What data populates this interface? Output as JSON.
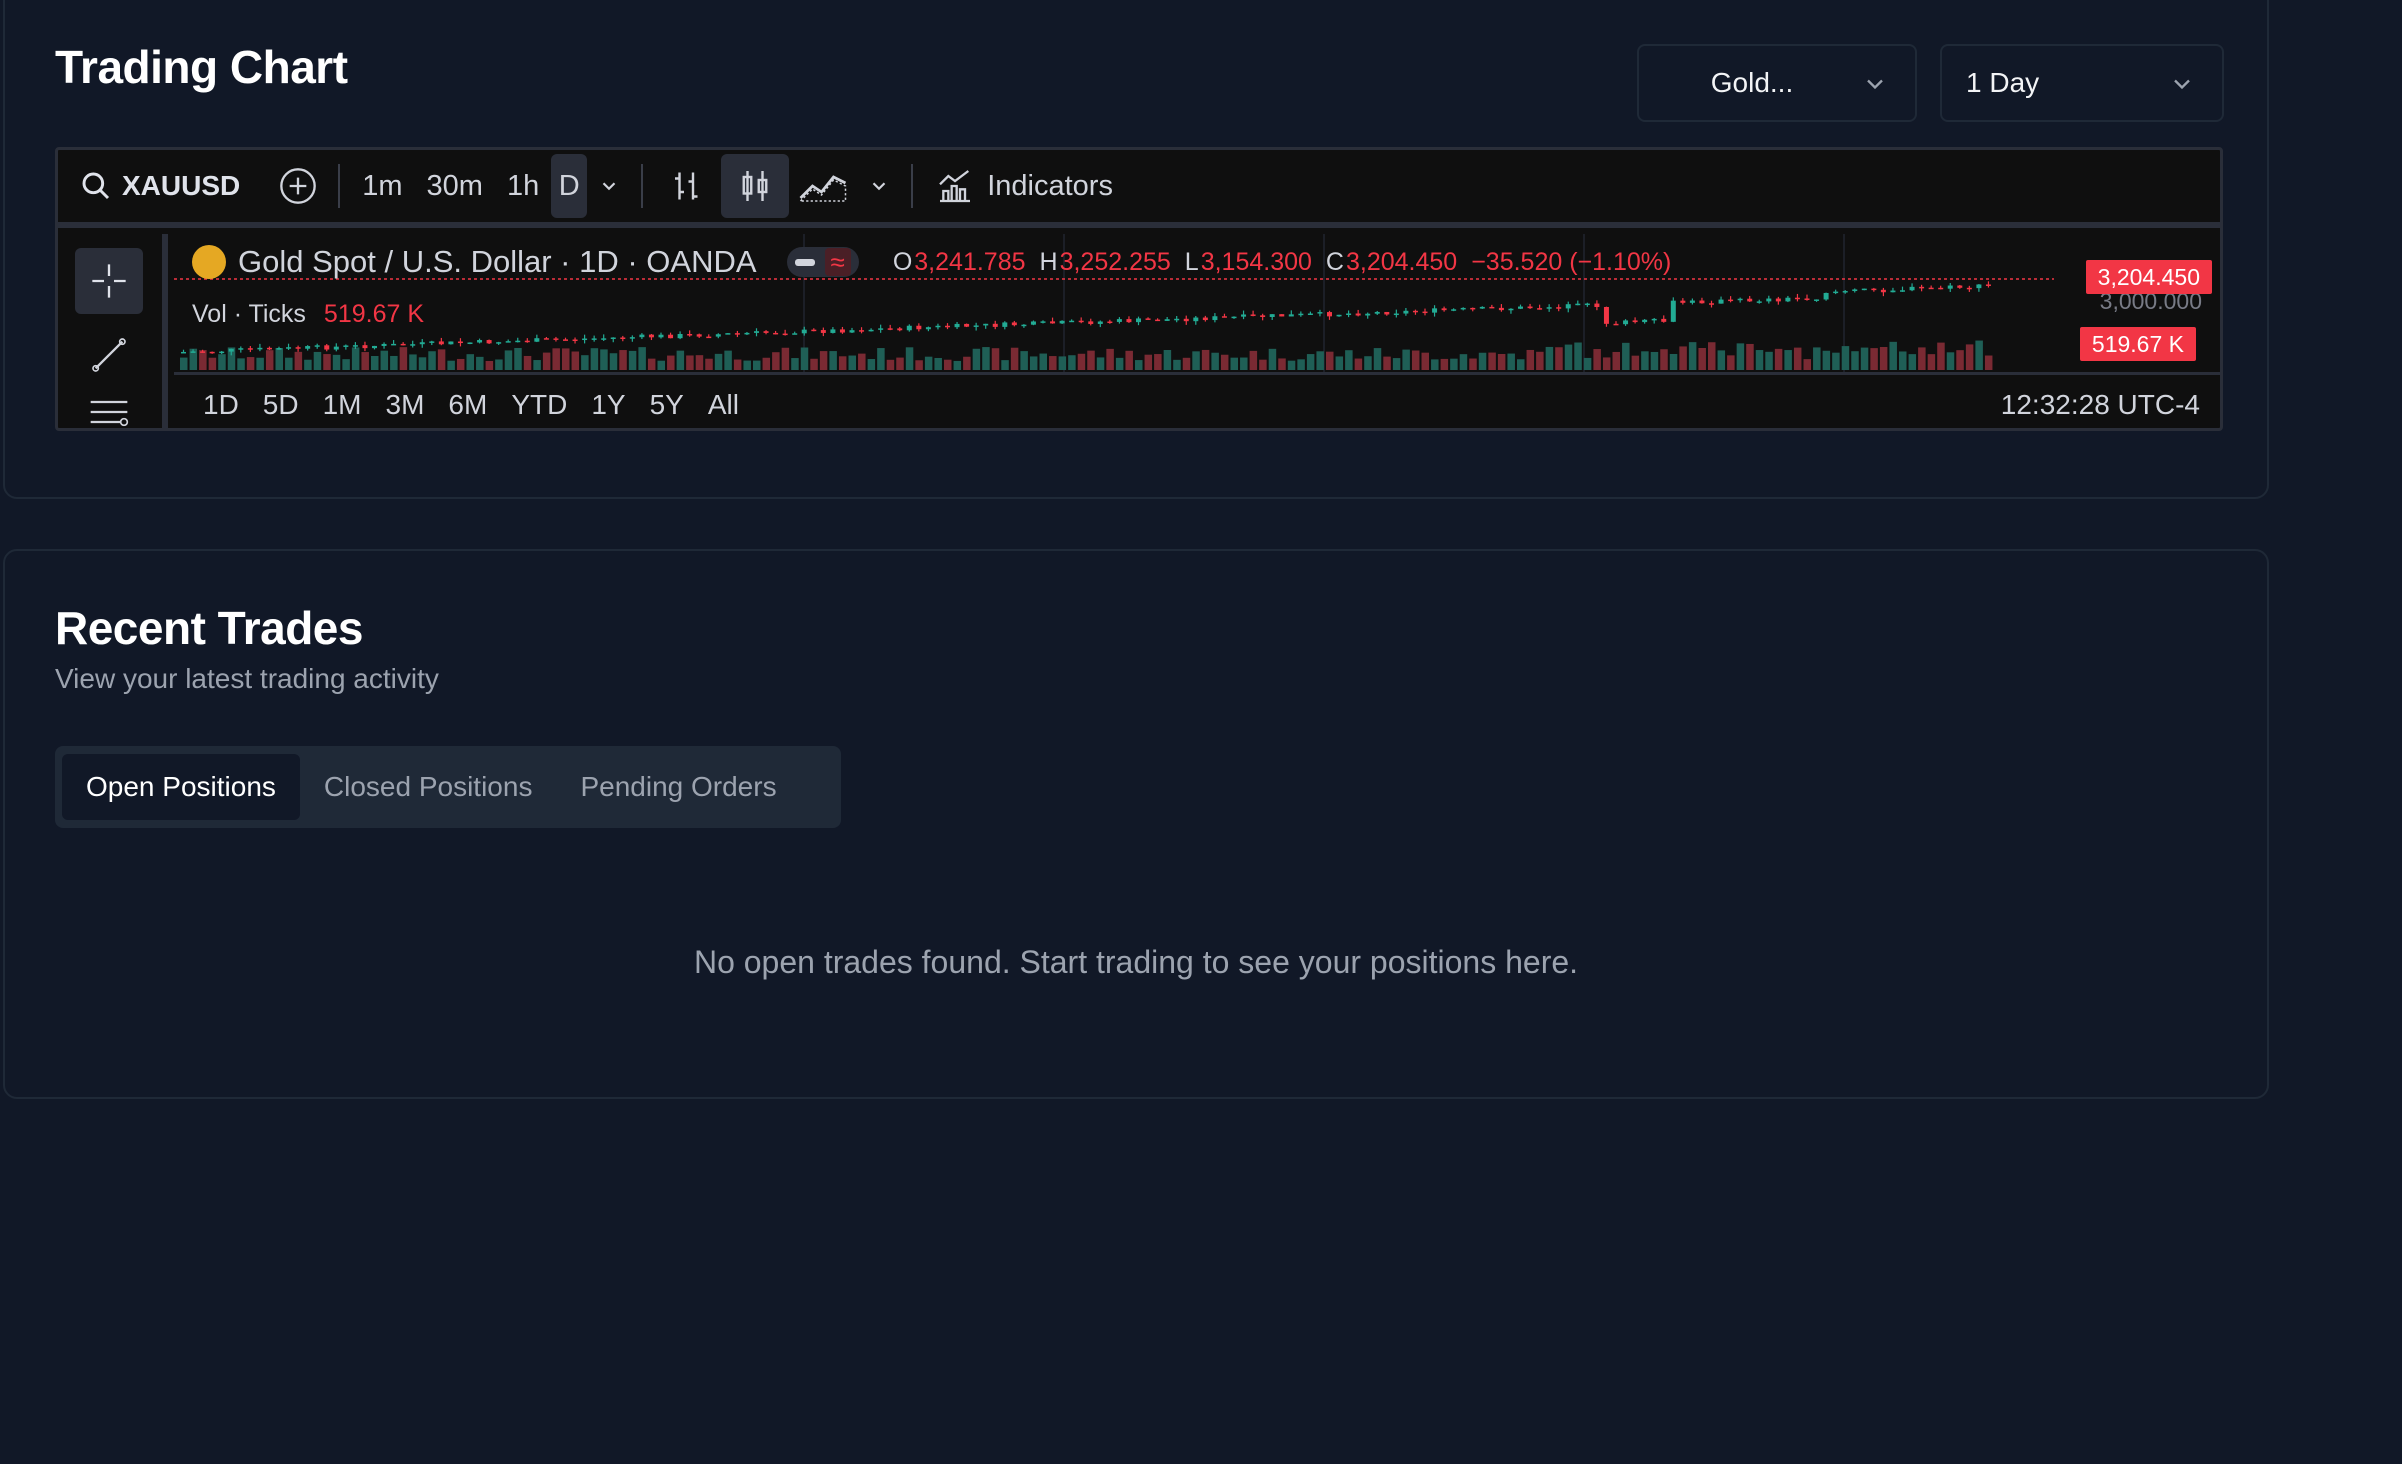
{
  "chart_section": {
    "title": "Trading Chart",
    "symbol_select": "Gold...",
    "range_select": "1 Day",
    "toolbar": {
      "symbol": "XAUUSD",
      "intervals": [
        "1m",
        "30m",
        "1h",
        "D"
      ],
      "active_interval": "D",
      "indicators_label": "Indicators"
    },
    "legend": {
      "instrument": "Gold Spot / U.S. Dollar · 1D · OANDA",
      "o_label": "O",
      "o_value": "3,241.785",
      "h_label": "H",
      "h_value": "3,252.255",
      "l_label": "L",
      "l_value": "3,154.300",
      "c_label": "C",
      "c_value": "3,204.450",
      "change": "−35.520 (−1.10%)",
      "vol_label": "Vol · Ticks",
      "vol_value": "519.67 K"
    },
    "price_axis": {
      "last_price": "3,204.450",
      "tick": "3,000.000",
      "volume_tag": "519.67 K"
    },
    "ranges": [
      "1D",
      "5D",
      "1M",
      "3M",
      "6M",
      "YTD",
      "1Y",
      "5Y",
      "All"
    ],
    "clock": "12:32:28 UTC-4",
    "colors": {
      "up": "#22ab94",
      "down": "#f23645",
      "accent": "#2962ff"
    }
  },
  "trades_section": {
    "title": "Recent Trades",
    "subtitle": "View your latest trading activity",
    "tabs": [
      "Open Positions",
      "Closed Positions",
      "Pending Orders"
    ],
    "active_tab": "Open Positions",
    "empty_message": "No open trades found. Start trading to see your positions here."
  }
}
